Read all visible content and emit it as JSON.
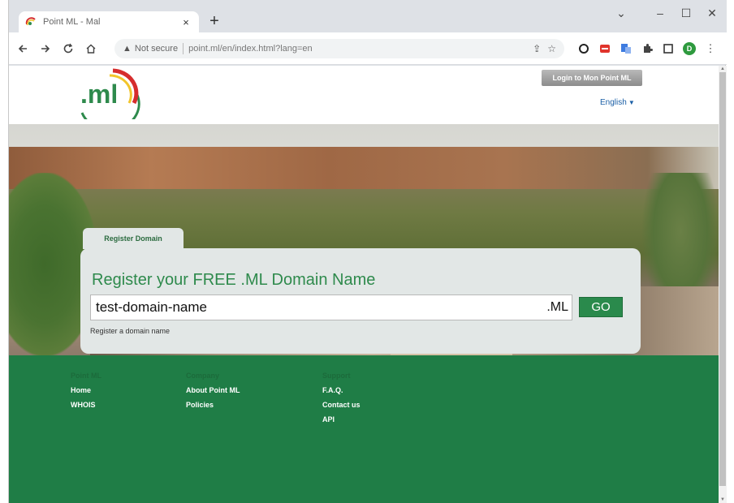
{
  "browser": {
    "tab_title": "Point ML - Mal",
    "tab_close": "×",
    "new_tab": "+",
    "window_controls": [
      "⌄",
      "–",
      "☐",
      "✕"
    ],
    "not_secure_label": "Not secure",
    "url": "point.ml/en/index.html?lang=en",
    "nav_icons": [
      "arrow-left-icon",
      "arrow-right-icon",
      "reload-icon",
      "home-icon"
    ],
    "extensions": [
      "share-icon",
      "star-icon",
      "opera-icon",
      "red-extension-icon",
      "blue-extension-icon",
      "puzzle-icon",
      "sidebar-icon",
      "profile-icon",
      "menu-icon"
    ],
    "profile_initial": "D"
  },
  "header": {
    "logo_text": ".ml",
    "login_button": "Login to Mon Point ML",
    "language": "English"
  },
  "register": {
    "tab_label": "Register Domain",
    "title": "Register your FREE .ML Domain Name",
    "input_value": "test-domain-name",
    "tld": ".ML",
    "go_button": "GO",
    "subtext": "Register a domain name"
  },
  "footer": {
    "columns": [
      {
        "heading": "Point ML",
        "links": [
          "Home",
          "WHOIS"
        ]
      },
      {
        "heading": "Company",
        "links": [
          "About Point ML",
          "Policies"
        ]
      },
      {
        "heading": "Support",
        "links": [
          "F.A.Q.",
          "Contact us",
          "API"
        ]
      }
    ]
  },
  "colors": {
    "brand_green": "#1f7d46",
    "title_green": "#2e8a4c",
    "logo_red": "#d62d2d",
    "logo_yellow": "#f2c52b"
  }
}
